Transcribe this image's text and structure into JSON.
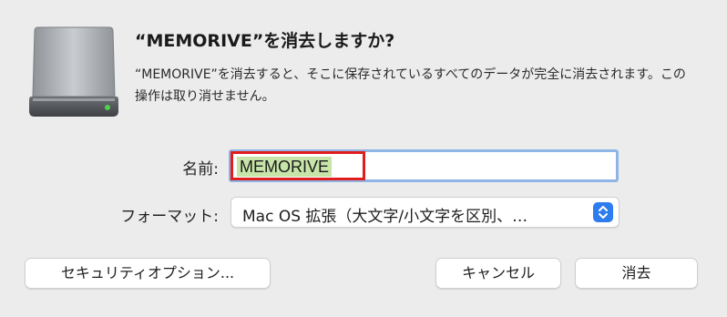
{
  "dialog": {
    "title": "“MEMORIVE”を消去しますか?",
    "message": "“MEMORIVE”を消去すると、そこに保存されているすべてのデータが完全に消去されます。この操作は取り消せません。"
  },
  "form": {
    "name_label": "名前:",
    "name_value": "MEMORIVE",
    "format_label": "フォーマット:",
    "format_value": "Mac OS 拡張（大文字/小文字を区別、…"
  },
  "buttons": {
    "security_options": "セキュリティオプション...",
    "cancel": "キャンセル",
    "erase": "消去"
  },
  "colors": {
    "accent": "#2d7cf0",
    "input_focus_ring": "#8eb5e6",
    "text_selection": "#c7e5a8",
    "annotation_box": "#e01e1e",
    "dialog_background": "#ececec"
  },
  "icons": {
    "drive": "external-drive-icon",
    "select_stepper": "chevron-up-down-icon"
  }
}
